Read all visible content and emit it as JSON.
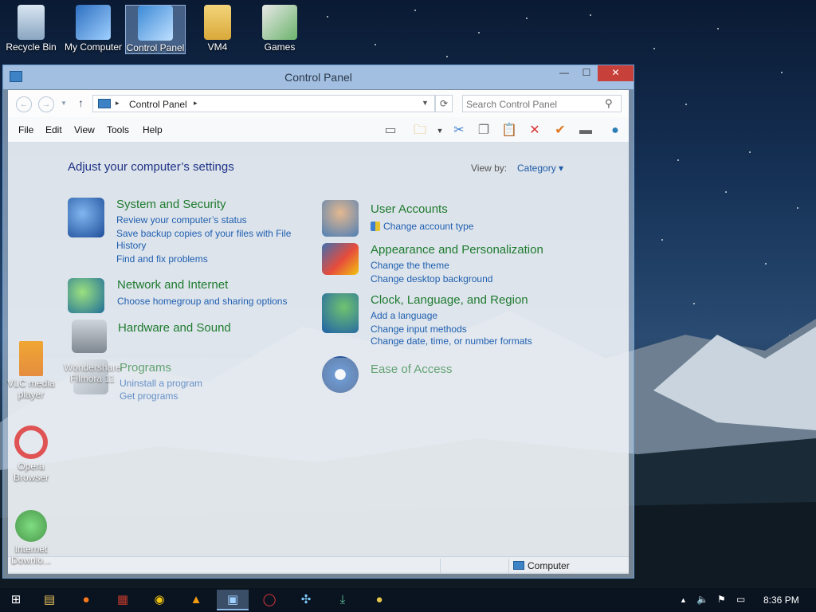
{
  "desktop": {
    "icons": [
      {
        "label": "Recycle Bin"
      },
      {
        "label": "My Computer"
      },
      {
        "label": "Control Panel"
      },
      {
        "label": "VM4"
      },
      {
        "label": "Games"
      }
    ],
    "left_icons": [
      {
        "label": "VLC media player"
      },
      {
        "label": "Wondershare Filmora 11"
      },
      {
        "label": "Opera Browser"
      },
      {
        "label": "Internet Downlo..."
      }
    ]
  },
  "window": {
    "title": "Control Panel",
    "controls": {
      "minimize": "—",
      "maximize": "☐",
      "close": "✕"
    },
    "address": {
      "crumb": "Control Panel",
      "separator": "▸"
    },
    "search": {
      "placeholder": "Search Control Panel"
    },
    "menu": [
      "File",
      "Edit",
      "View",
      "Tools",
      "Help"
    ],
    "heading": "Adjust your computer’s settings",
    "view_by_label": "View by:",
    "view_by_value": "Category ▾",
    "categories": [
      {
        "title": "System and Security",
        "icon": "shield-icon",
        "links": [
          "Review your computer’s status",
          "Save backup copies of your files with File",
          "History",
          "Find and fix problems"
        ]
      },
      {
        "title": "Network and Internet",
        "icon": "globe-network-icon",
        "links": [
          "Choose homegroup and sharing options"
        ]
      },
      {
        "title": "Hardware and Sound",
        "icon": "printer-icon",
        "links": []
      },
      {
        "title": "Programs",
        "icon": "programs-icon",
        "links": [
          "Uninstall a program",
          "Get programs"
        ]
      },
      {
        "title": "User Accounts",
        "icon": "users-icon",
        "links": [
          "Change account type"
        ]
      },
      {
        "title": "Appearance and Personalization",
        "icon": "display-palette-icon",
        "links": [
          "Change the theme",
          "Change desktop background"
        ]
      },
      {
        "title": "Clock, Language, and Region",
        "icon": "clock-globe-icon",
        "links": [
          "Add a language",
          "Change input methods",
          "Change date, time, or number formats"
        ]
      },
      {
        "title": "Ease of Access",
        "icon": "ease-of-access-icon",
        "links": []
      }
    ],
    "status": "Computer"
  },
  "taskbar": {
    "clock": "8:36 PM",
    "tray": {
      "chevron": "▲"
    }
  },
  "colors": {
    "category_title": "#1e7b2f",
    "link": "#1f5fb0",
    "heading": "#1e3287",
    "close_button": "#c7403a"
  }
}
